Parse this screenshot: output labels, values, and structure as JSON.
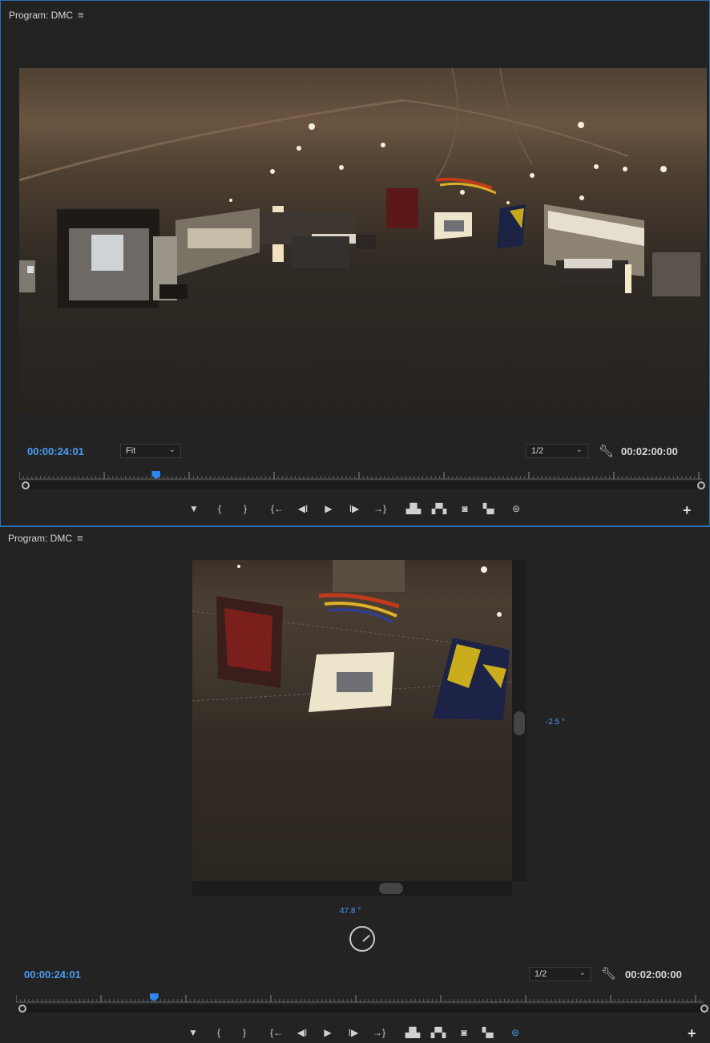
{
  "panels": [
    {
      "title": "Program: DMC",
      "timecode": "00:00:24:01",
      "zoom": "Fit",
      "resolution": "1/2",
      "duration": "00:02:00:00",
      "playhead_fraction": 0.2,
      "view_mode": "equirectangular"
    },
    {
      "title": "Program: DMC",
      "timecode": "00:00:24:01",
      "resolution": "1/2",
      "duration": "00:02:00:00",
      "playhead_fraction": 0.2,
      "vertical_angle": "-2.5 °",
      "horizontal_angle": "47.8 °",
      "view_mode": "vr"
    }
  ],
  "controls": [
    {
      "name": "marker-button",
      "glyph": "▼"
    },
    {
      "name": "mark-in-button",
      "glyph": "{"
    },
    {
      "name": "mark-out-button",
      "glyph": "}"
    },
    {
      "name": "go-to-in-button",
      "glyph": "{←"
    },
    {
      "name": "step-back-button",
      "glyph": "◀I"
    },
    {
      "name": "play-button",
      "glyph": "▶"
    },
    {
      "name": "step-forward-button",
      "glyph": "I▶"
    },
    {
      "name": "go-to-out-button",
      "glyph": "→}"
    },
    {
      "name": "lift-button",
      "glyph": "▟▙"
    },
    {
      "name": "extract-button",
      "glyph": "▞▚"
    },
    {
      "name": "export-frame-button",
      "glyph": "◙"
    },
    {
      "name": "comparison-view-button",
      "glyph": "▚▖"
    },
    {
      "name": "vr-video-toggle-button",
      "glyph": "⊜"
    }
  ],
  "colors": {
    "accent": "#4a9cf5",
    "panel_bg": "#232323"
  }
}
